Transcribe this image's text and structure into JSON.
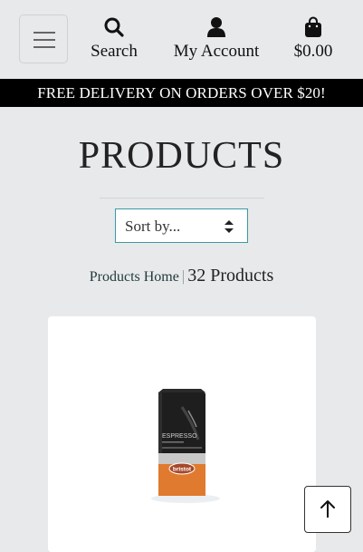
{
  "header": {
    "search_label": "Search",
    "account_label": "My Account",
    "cart_total": "$0.00"
  },
  "banner": {
    "text": "FREE DELIVERY ON ORDERS OVER $20!"
  },
  "main": {
    "title": "PRODUCTS",
    "sort": {
      "selected": "Sort by..."
    },
    "breadcrumb": {
      "home_link": "Products Home",
      "separator": "|",
      "count": "32 Products"
    }
  },
  "product": {
    "package_line": "ESPRESSO",
    "brand": "bristot"
  },
  "icons": {
    "menu": "hamburger-icon",
    "search": "search-icon",
    "account": "user-icon",
    "cart": "shopping-bag-icon",
    "sort": "sort-arrows-icon",
    "back_to_top": "arrow-up-icon"
  },
  "colors": {
    "page_bg": "#e8e9eb",
    "banner_bg": "#000000",
    "sort_border": "#3a9aa5",
    "package_accent": "#e07a2e"
  }
}
